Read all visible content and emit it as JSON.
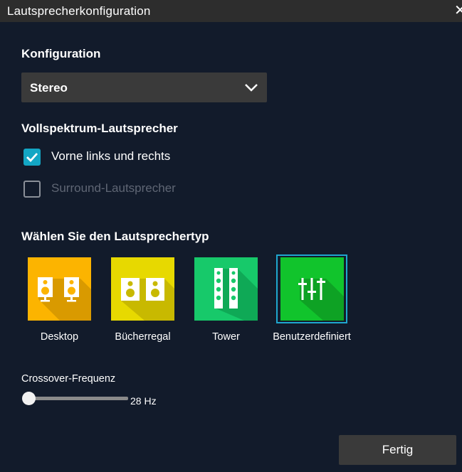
{
  "window": {
    "title": "Lautsprecherkonfiguration",
    "close_icon": "close-icon"
  },
  "config": {
    "label": "Konfiguration",
    "selected": "Stereo",
    "chevron_icon": "chevron-down-icon"
  },
  "fullrange": {
    "label": "Vollspektrum-Lautsprecher",
    "options": [
      {
        "label": "Vorne links und rechts",
        "checked": true
      },
      {
        "label": "Surround-Lautsprecher",
        "checked": false
      }
    ]
  },
  "speaker_type": {
    "label": "Wählen Sie den Lautsprechertyp",
    "tiles": [
      {
        "label": "Desktop",
        "color": "#fcb400",
        "icon": "desktop-speakers-icon"
      },
      {
        "label": "Bücherregal",
        "color": "#e7d900",
        "icon": "bookshelf-speakers-icon"
      },
      {
        "label": "Tower",
        "color": "#17c96a",
        "icon": "tower-speakers-icon"
      },
      {
        "label": "Benutzerdefiniert",
        "color": "#11c42c",
        "icon": "custom-sliders-icon",
        "selected": true
      }
    ]
  },
  "crossover": {
    "label": "Crossover-Frequenz",
    "value_text": "28 Hz",
    "level": 0
  },
  "actions": {
    "done": "Fertig"
  },
  "colors": {
    "background": "#121b2b",
    "titlebar": "#2d2d2d",
    "accent": "#13a6c4",
    "control": "#3a3a3a"
  }
}
